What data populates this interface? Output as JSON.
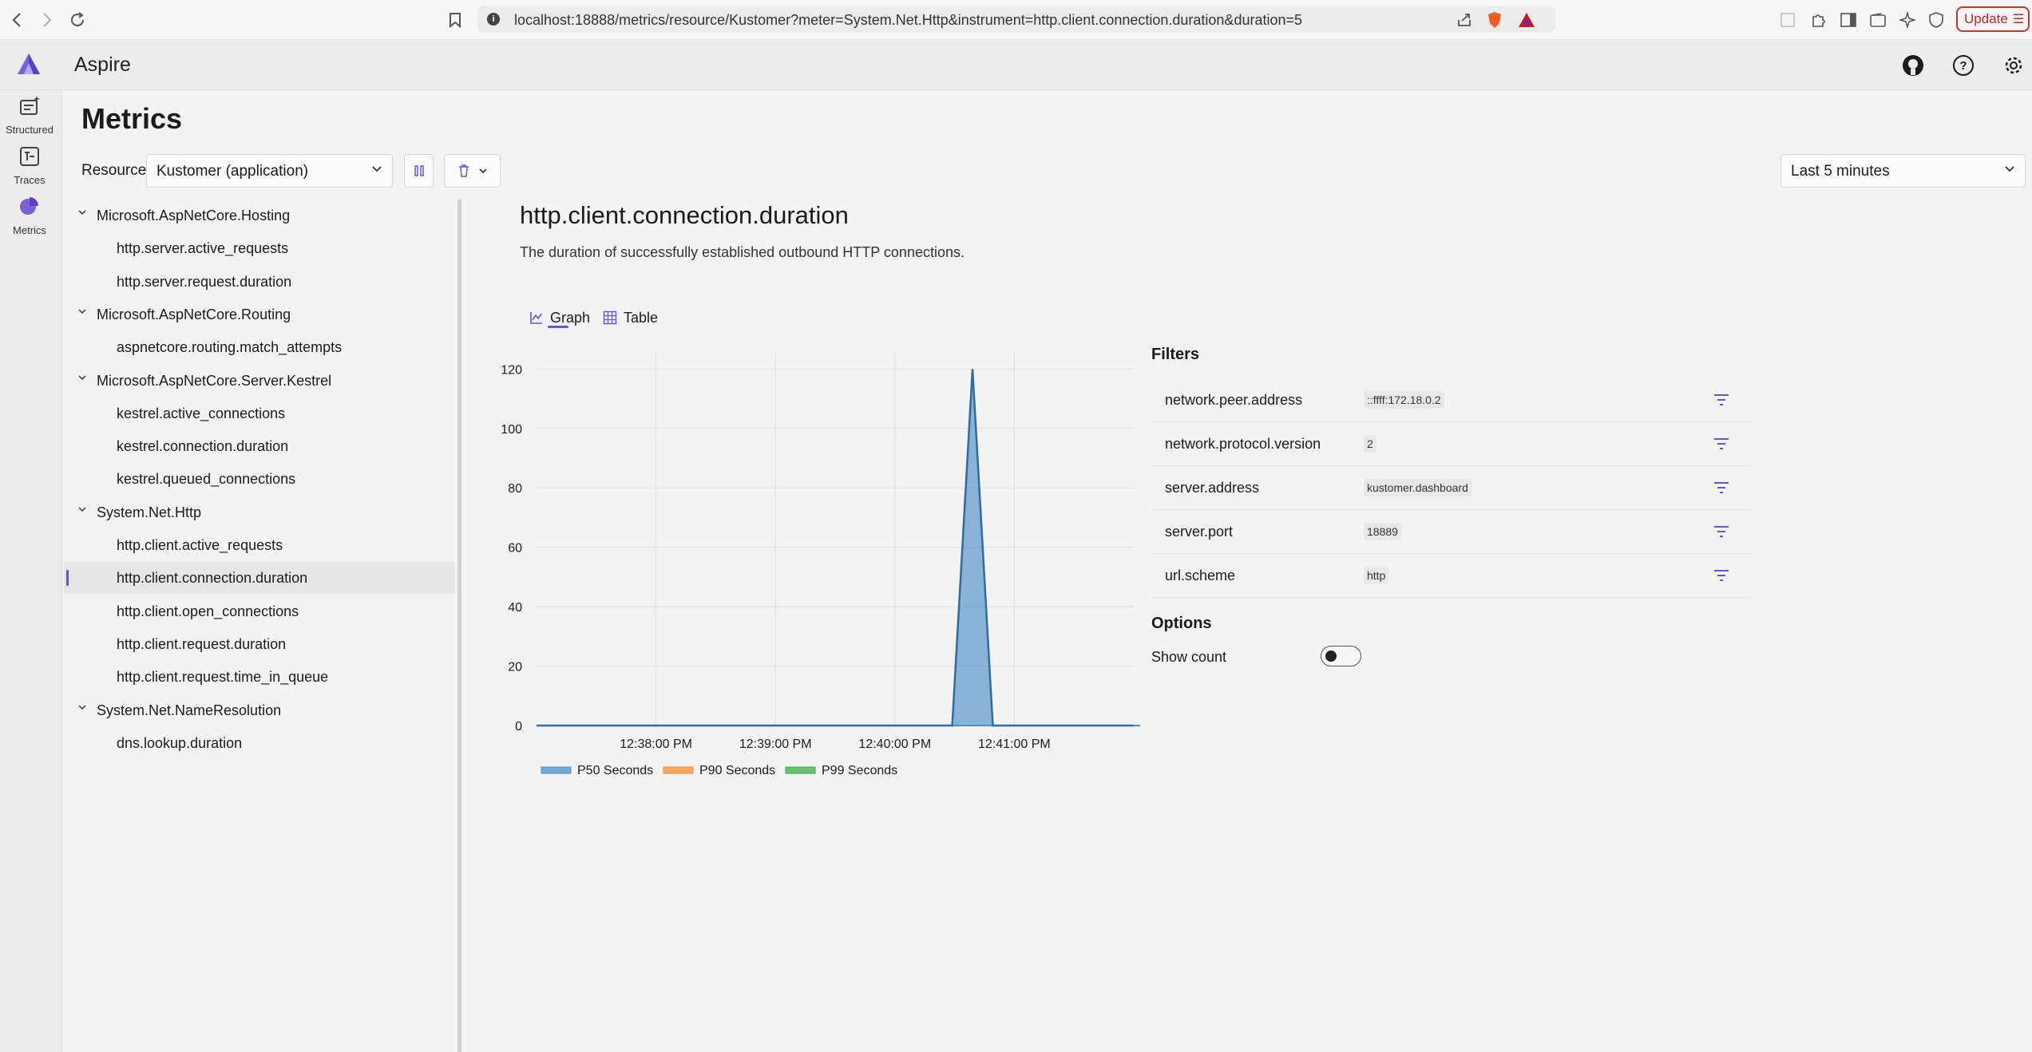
{
  "browser": {
    "url": "localhost:18888/metrics/resource/Kustomer?meter=System.Net.Http&instrument=http.client.connection.duration&duration=5",
    "update_label": "Update"
  },
  "app": {
    "title": "Aspire"
  },
  "rail": {
    "items": [
      {
        "label": "Structured",
        "icon": "structured-logs-icon"
      },
      {
        "label": "Traces",
        "icon": "traces-icon"
      },
      {
        "label": "Metrics",
        "icon": "metrics-icon"
      }
    ]
  },
  "page": {
    "title": "Metrics",
    "resource_label": "Resource",
    "resource_value": "Kustomer (application)",
    "time_range": "Last 5 minutes"
  },
  "tree": [
    {
      "label": "Microsoft.AspNetCore.Hosting",
      "level": 0
    },
    {
      "label": "http.server.active_requests",
      "level": 1
    },
    {
      "label": "http.server.request.duration",
      "level": 1
    },
    {
      "label": "Microsoft.AspNetCore.Routing",
      "level": 0
    },
    {
      "label": "aspnetcore.routing.match_attempts",
      "level": 1
    },
    {
      "label": "Microsoft.AspNetCore.Server.Kestrel",
      "level": 0
    },
    {
      "label": "kestrel.active_connections",
      "level": 1
    },
    {
      "label": "kestrel.connection.duration",
      "level": 1
    },
    {
      "label": "kestrel.queued_connections",
      "level": 1
    },
    {
      "label": "System.Net.Http",
      "level": 0
    },
    {
      "label": "http.client.active_requests",
      "level": 1
    },
    {
      "label": "http.client.connection.duration",
      "level": 1,
      "selected": true
    },
    {
      "label": "http.client.open_connections",
      "level": 1
    },
    {
      "label": "http.client.request.duration",
      "level": 1
    },
    {
      "label": "http.client.request.time_in_queue",
      "level": 1
    },
    {
      "label": "System.Net.NameResolution",
      "level": 0
    },
    {
      "label": "dns.lookup.duration",
      "level": 1
    }
  ],
  "metric": {
    "title": "http.client.connection.duration",
    "description": "The duration of successfully established outbound HTTP connections.",
    "tabs": {
      "graph": "Graph",
      "table": "Table"
    }
  },
  "chart_data": {
    "type": "area",
    "x_ticks": [
      "12:38:00 PM",
      "12:39:00 PM",
      "12:40:00 PM",
      "12:41:00 PM"
    ],
    "y_ticks": [
      0,
      20,
      40,
      60,
      80,
      100,
      120
    ],
    "ylim": [
      0,
      126
    ],
    "x_range_minutes": [
      -1.0,
      4.0
    ],
    "series": [
      {
        "name": "P50 Seconds",
        "color": "#4e91c6",
        "points": [
          [
            -1.0,
            0
          ],
          [
            2.48,
            0
          ],
          [
            2.65,
            120
          ],
          [
            2.82,
            0
          ],
          [
            4.0,
            0
          ]
        ]
      },
      {
        "name": "P90 Seconds",
        "color": "#f58d33",
        "points": []
      },
      {
        "name": "P99 Seconds",
        "color": "#3fae49",
        "points": []
      }
    ],
    "grid": true,
    "legend": "bottom-left"
  },
  "filters": {
    "title": "Filters",
    "items": [
      {
        "name": "network.peer.address",
        "value": "::ffff:172.18.0.2"
      },
      {
        "name": "network.protocol.version",
        "value": "2"
      },
      {
        "name": "server.address",
        "value": "kustomer.dashboard"
      },
      {
        "name": "server.port",
        "value": "18889"
      },
      {
        "name": "url.scheme",
        "value": "http"
      }
    ]
  },
  "options": {
    "title": "Options",
    "show_count_label": "Show count",
    "show_count": false
  }
}
